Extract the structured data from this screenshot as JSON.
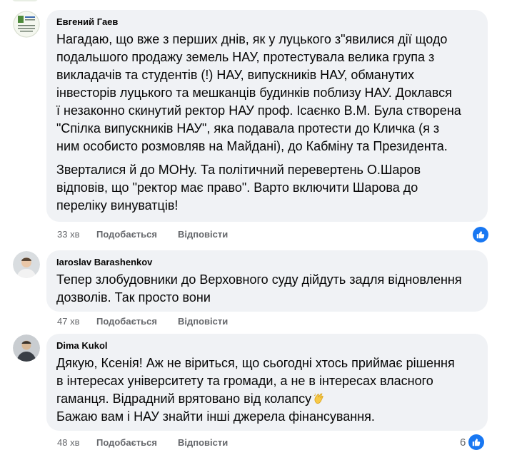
{
  "comments": [
    {
      "author": "Евгений Гаев",
      "paragraphs": [
        [
          "Нагадаю, що вже з перших днів, як у луцького з\"явилися дії щодо",
          "подальшого продажу земель НАУ, протестувала велика група з",
          "викладачів та студентів (!) НАУ, випускників НАУ, обманутих",
          "інвесторів луцького та мешканців будинків поблизу НАУ. Доклався",
          "ї незаконно скинутий ректор НАУ проф. Ісаєнко В.М. Була створена",
          "\"Спілка випускників НАУ\", яка подавала протести до Кличка (я з",
          "ним особисто розмовляв на Майдані), до Кабміну та Президента."
        ],
        [
          "Зверталися й до МОНу. Та політичний перевертень О.Шаров",
          "відповів, що \"ректор має право\". Варто включити Шарова до",
          "переліку винуватців!"
        ]
      ],
      "time": "33 хв",
      "like_label": "Подобається",
      "reply_label": "Відповісти",
      "reaction_count": ""
    },
    {
      "author": "Iaroslav Barashenkov",
      "paragraphs": [
        [
          "Тепер злобудовники до Верховного суду дійдуть задля відновлення",
          "дозволів. Так просто вони"
        ]
      ],
      "time": "47 хв",
      "like_label": "Подобається",
      "reply_label": "Відповісти",
      "reaction_count": ""
    },
    {
      "author": "Dima Kukol",
      "paragraphs": [
        [
          "Дякую, Ксенія! Аж не віриться, що сьогодні хтось приймає рішення",
          "в інтересах університету та громади, а не в інтересах власного",
          "гаманця. Відрадний врятовано від колапсу",
          "Бажаю вам і НАУ знайти інші джерела фінансування."
        ]
      ],
      "emoji_after_line": 2,
      "time": "48 хв",
      "like_label": "Подобається",
      "reply_label": "Відповісти",
      "reaction_count": "6"
    }
  ],
  "icons": {
    "reaction": "like-thumb-icon",
    "emoji": "clapping-hands-icon"
  },
  "colors": {
    "bubble": "#f0f2f5",
    "like_blue": "#1877f2",
    "meta_gray": "#65676b"
  }
}
